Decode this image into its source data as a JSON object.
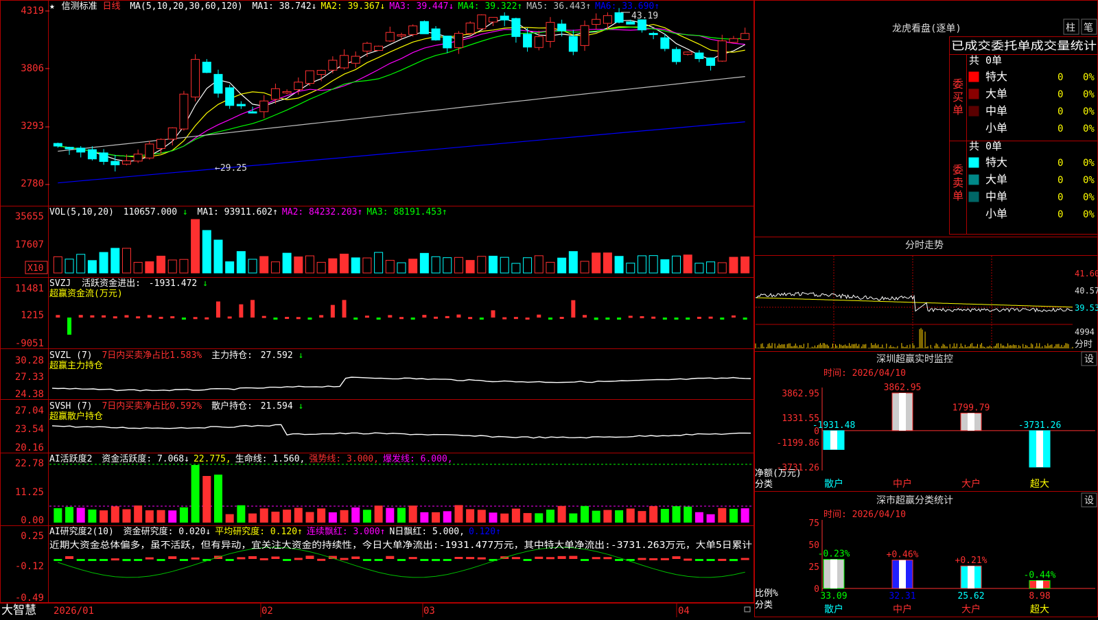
{
  "app": {
    "logo": "大智慧",
    "colors": {
      "up": "#ff3030",
      "down": "#00ffff",
      "grid": "#b00000"
    }
  },
  "kline": {
    "star": "★",
    "stock_name": "信测标准",
    "period": "日线",
    "ma_label": "MA(5,10,20,30,60,120)",
    "ma_values": [
      {
        "label": "MA1:",
        "value": "38.742",
        "arrow": "↓",
        "color": "#ffffff"
      },
      {
        "label": "MA2:",
        "value": "39.367",
        "arrow": "↓",
        "color": "#ffff00"
      },
      {
        "label": "MA3:",
        "value": "39.447",
        "arrow": "↓",
        "color": "#ff00ff"
      },
      {
        "label": "MA4:",
        "value": "39.322",
        "arrow": "↑",
        "color": "#00ff00"
      },
      {
        "label": "MA5:",
        "value": "36.443",
        "arrow": "↑",
        "color": "#c0c0c0"
      },
      {
        "label": "MA6:",
        "value": "33.690",
        "arrow": "↑",
        "color": "#0000ff"
      }
    ],
    "y_ticks": [
      "4319",
      "3806",
      "3293",
      "2780"
    ],
    "high_note": "43.19",
    "low_note": "←29.25"
  },
  "volume": {
    "label": "VOL(5,10,20)",
    "value": "110657.000",
    "arrow": "↓",
    "ma": [
      {
        "label": "MA1:",
        "value": "93911.602",
        "arrow": "↑",
        "color": "#ffffff"
      },
      {
        "label": "MA2:",
        "value": "84232.203",
        "arrow": "↑",
        "color": "#ff00ff"
      },
      {
        "label": "MA3:",
        "value": "88191.453",
        "arrow": "↑",
        "color": "#00ff00"
      }
    ],
    "y_ticks": [
      "35655",
      "17607"
    ],
    "unit": "X10"
  },
  "svzj": {
    "label": "SVZJ",
    "desc": "活跃资金进出:",
    "value": "-1931.472",
    "arrow": "↓",
    "sub": "超赢资金流(万元)",
    "y_ticks": [
      "11481",
      "1215",
      "-9051"
    ]
  },
  "svzl": {
    "label": "SVZL (7)",
    "desc": "7日内买卖净占比1.583%",
    "hold_label": "主力持仓:",
    "hold_value": "27.592",
    "arrow": "↓",
    "sub": "超赢主力持仓",
    "y_ticks": [
      "30.28",
      "27.33",
      "24.38"
    ]
  },
  "svsh": {
    "label": "SVSH (7)",
    "desc": "7日内买卖净占比0.592%",
    "hold_label": "散户持仓:",
    "hold_value": "21.594",
    "arrow": "↓",
    "sub": "超赢散户持仓",
    "y_ticks": [
      "27.04",
      "23.54",
      "20.16"
    ]
  },
  "ai_active": {
    "label": "AI活跃度2",
    "items": [
      {
        "text": "资金活跃度: 7.068",
        "arrow": "↓",
        "color": "#ffffff"
      },
      {
        "text": "22.775",
        "arrow": ",",
        "color": "#ffff00"
      },
      {
        "text": "生命线: 1.560",
        "arrow": ",",
        "color": "#ffffff"
      },
      {
        "text": "强势线: 3.000",
        "arrow": ",",
        "color": "#ff3030"
      },
      {
        "text": "爆发线: 6.000",
        "arrow": ",",
        "color": "#ff00ff"
      }
    ],
    "y_ticks": [
      "22.78",
      "11.25",
      "0.00"
    ]
  },
  "ai_research": {
    "label": "AI研究度2(10)",
    "items": [
      {
        "text": "资金研究度: 0.020",
        "arrow": "↓",
        "color": "#ffffff"
      },
      {
        "text": "平均研究度: 0.120",
        "arrow": "↑",
        "color": "#ffff00"
      },
      {
        "text": "连续飘红: 3.000",
        "arrow": "↑",
        "color": "#ff00ff"
      },
      {
        "text": "N日飘红: 5.000",
        "arrow": ",",
        "color": "#ffffff"
      },
      {
        "text": "0.120",
        "arrow": "↑",
        "color": "#0000ff"
      }
    ],
    "comment": "近期大资金总体偏多，虽不活跃，但有异动，宜关注大资金的持续性，今日大单净流出:-1931.477万元，其中特大单净流出:-3731.263万元，大单5日累计",
    "y_ticks": [
      "0.25",
      "-0.12",
      "-0.49"
    ]
  },
  "xaxis": {
    "labels": [
      "2026/01",
      "02",
      "03",
      "04"
    ]
  },
  "dragon": {
    "title": "龙虎看盘(逐单)",
    "btn_bar": "柱",
    "btn_pen": "笔",
    "tabs": [
      "已成交委托单成交量统计"
    ],
    "buy": {
      "total": "共 0单",
      "side_label": "委买单",
      "rows": [
        {
          "name": "特大",
          "count": "0",
          "pct": "0%",
          "color": "#ff0000"
        },
        {
          "name": "大单",
          "count": "0",
          "pct": "0%",
          "color": "#8a0000"
        },
        {
          "name": "中单",
          "count": "0",
          "pct": "0%",
          "color": "#5a0000"
        },
        {
          "name": "小单",
          "count": "0",
          "pct": "0%",
          "color": "#000000"
        }
      ]
    },
    "sell": {
      "total": "共 0单",
      "side_label": "委卖单",
      "rows": [
        {
          "name": "特大",
          "count": "0",
          "pct": "0%",
          "color": "#00ffff"
        },
        {
          "name": "大单",
          "count": "0",
          "pct": "0%",
          "color": "#008888"
        },
        {
          "name": "中单",
          "count": "0",
          "pct": "0%",
          "color": "#006666"
        },
        {
          "name": "小单",
          "count": "0",
          "pct": "0%",
          "color": "#000000"
        }
      ]
    }
  },
  "intraday": {
    "title": "分时走势",
    "y_labels": [
      "41.60",
      "40.57",
      "39.53"
    ],
    "vol_label": "4994",
    "unit": "分时"
  },
  "monitor": {
    "title": "深圳超赢实时监控",
    "btn": "设",
    "time": "时间: 2026/04/10",
    "y_ticks": [
      "3862.95",
      "1331.55",
      "0",
      "-1199.86",
      "-3731.26"
    ],
    "y_unit": "净额(万元)",
    "x_caption": "分类",
    "categories": [
      "散户",
      "中户",
      "大户",
      "超大"
    ],
    "values": [
      -1931.48,
      3862.95,
      1799.79,
      -3731.26
    ],
    "value_labels": [
      "-1931.48",
      "3862.95",
      "1799.79",
      "-3731.26"
    ],
    "ylim": [
      -3731.26,
      3862.95
    ]
  },
  "stats": {
    "title": "深市超赢分类统计",
    "btn": "设",
    "time": "时间: 2026/04/10",
    "y_ticks": [
      "75",
      "50",
      "25",
      "0"
    ],
    "y_unit": "比例%",
    "x_caption": "分类",
    "categories": [
      "散户",
      "中户",
      "大户",
      "超大"
    ],
    "values": [
      33.09,
      32.31,
      25.62,
      8.98
    ],
    "value_labels": [
      "33.09",
      "32.31",
      "25.62",
      "8.98"
    ],
    "changes": [
      "-0.23%",
      "+0.46%",
      "+0.21%",
      "-0.44%"
    ],
    "ylim": [
      0,
      75
    ]
  },
  "chart_data": [
    {
      "type": "bar",
      "title": "深圳超赢实时监控",
      "ylabel": "净额(万元)",
      "xlabel": "分类",
      "categories": [
        "散户",
        "中户",
        "大户",
        "超大"
      ],
      "values": [
        -1931.48,
        3862.95,
        1799.79,
        -3731.26
      ],
      "ylim": [
        -3731.26,
        3862.95
      ]
    },
    {
      "type": "bar",
      "title": "深市超赢分类统计",
      "ylabel": "比例%",
      "xlabel": "分类",
      "categories": [
        "散户",
        "中户",
        "大户",
        "超大"
      ],
      "values": [
        33.09,
        32.31,
        25.62,
        8.98
      ],
      "ylim": [
        0,
        75
      ]
    }
  ]
}
